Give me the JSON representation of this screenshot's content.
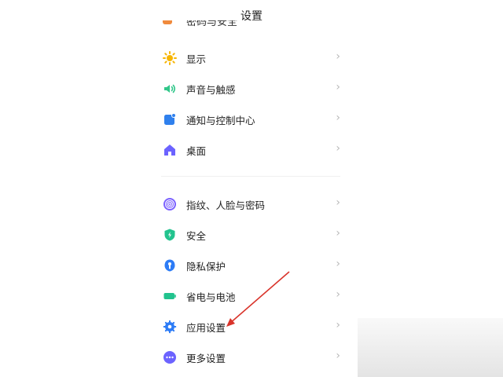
{
  "header": {
    "title": "设置"
  },
  "list": {
    "clipped_label": "密码与安全",
    "items": [
      {
        "key": "display",
        "label": "显示",
        "icon": "sun-icon",
        "color": "#F7B500"
      },
      {
        "key": "sound",
        "label": "声音与触感",
        "icon": "speaker-icon",
        "color": "#32C78A"
      },
      {
        "key": "notifications",
        "label": "通知与控制中心",
        "icon": "notification-icon",
        "color": "#2F80ED"
      },
      {
        "key": "desktop",
        "label": "桌面",
        "icon": "home-icon",
        "color": "#6C63FF"
      },
      {
        "key": "fingerprint",
        "label": "指纹、人脸与密码",
        "icon": "fingerprint-icon",
        "color": "#7B61FF"
      },
      {
        "key": "security",
        "label": "安全",
        "icon": "shield-icon",
        "color": "#22C38E"
      },
      {
        "key": "privacy",
        "label": "隐私保护",
        "icon": "privacy-icon",
        "color": "#2D7CF6"
      },
      {
        "key": "battery",
        "label": "省电与电池",
        "icon": "battery-icon",
        "color": "#22C38E"
      },
      {
        "key": "apps",
        "label": "应用设置",
        "icon": "gear-icon",
        "color": "#2D7CF6"
      },
      {
        "key": "more",
        "label": "更多设置",
        "icon": "more-icon",
        "color": "#6C63FF"
      }
    ]
  },
  "ui": {
    "chevron": "›"
  }
}
